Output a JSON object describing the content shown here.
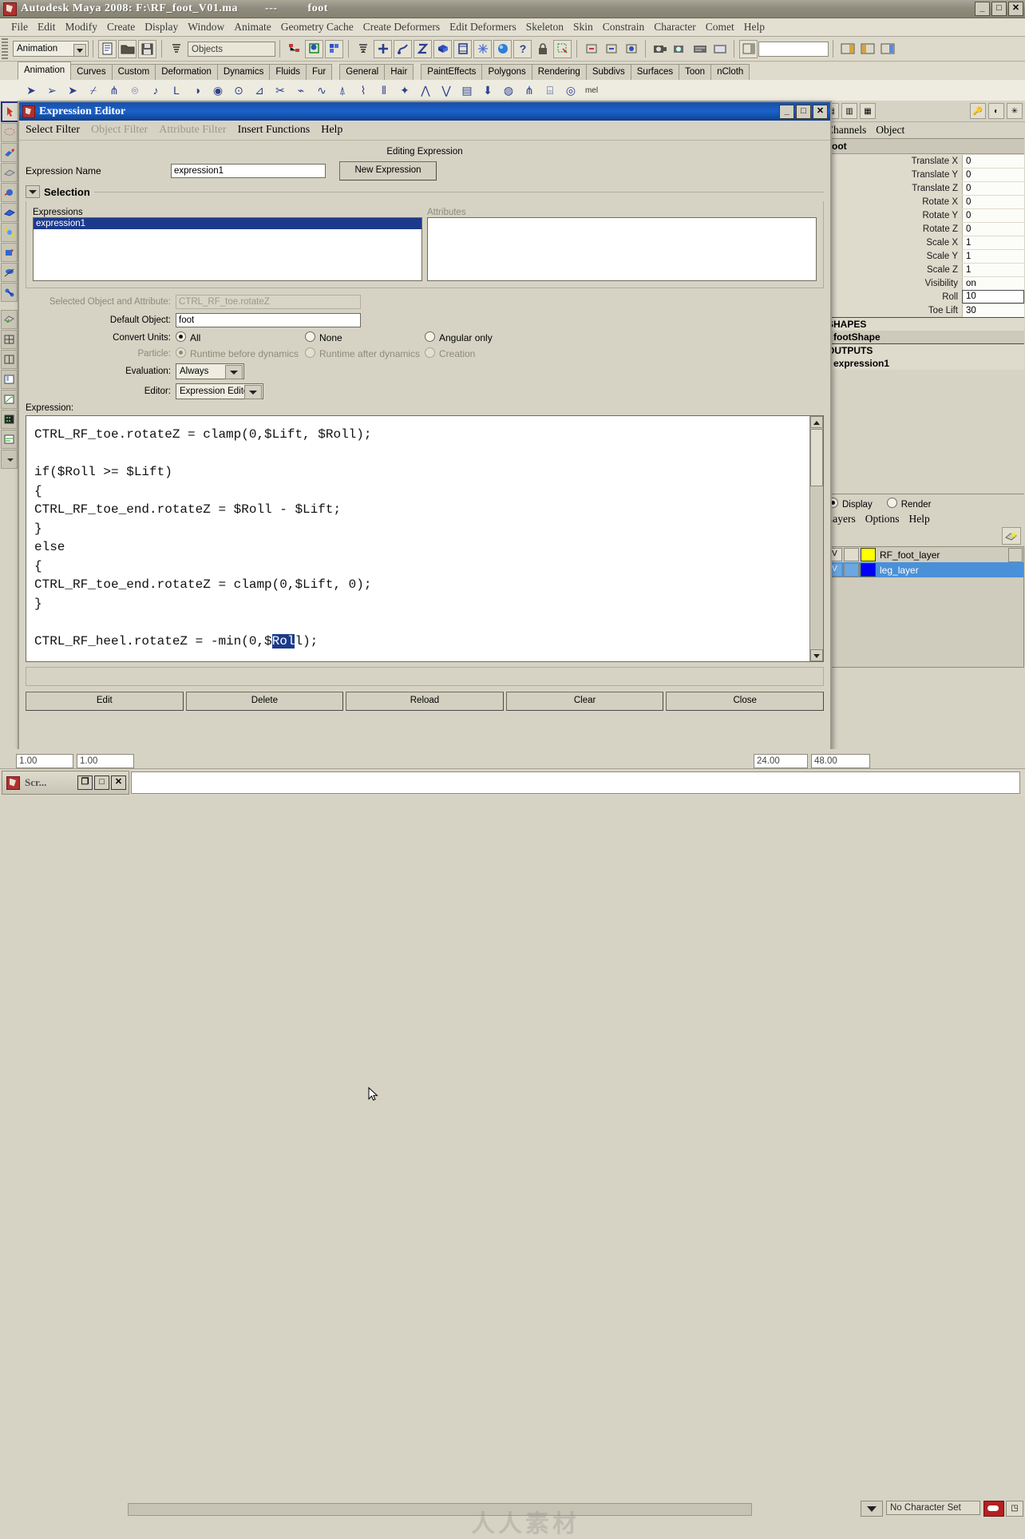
{
  "app": {
    "title": "Autodesk Maya 2008: F:\\RF_foot_V01.ma",
    "title_dash": "---",
    "title_object": "foot",
    "window_buttons": [
      "_",
      "□",
      "✕"
    ]
  },
  "menubar": {
    "items": [
      "File",
      "Edit",
      "Modify",
      "Create",
      "Display",
      "Window",
      "Animate",
      "Geometry Cache",
      "Create Deformers",
      "Edit Deformers",
      "Skeleton",
      "Skin",
      "Constrain",
      "Character",
      "Comet",
      "Help"
    ]
  },
  "toolbar": {
    "mode": "Animation",
    "selection_mask": "Objects",
    "numeric_input": "",
    "icons": [
      "new-scene-icon",
      "open-scene-icon",
      "save-scene-icon",
      "select-hierarchy-icon",
      "select-by-object-icon",
      "select-by-component-icon",
      "snap-grid-icon",
      "snap-curve-icon",
      "snap-point-icon",
      "snap-view-plane-icon",
      "snap-surface-icon",
      "construction-plane-icon",
      "make-live-icon",
      "history-icon",
      "render-icon",
      "help-icon",
      "lock-icon",
      "selection-set-icon"
    ]
  },
  "shelf": {
    "tabs": [
      "Animation",
      "Curves",
      "Custom",
      "Deformation",
      "Dynamics",
      "Fluids",
      "Fur",
      "General",
      "Hair",
      "PaintEffects",
      "Polygons",
      "Rendering",
      "Subdivs",
      "Surfaces",
      "Toon",
      "nCloth"
    ],
    "active_tab": "Animation",
    "last_icon_label": "mel"
  },
  "expression_editor": {
    "window_title": "Expression Editor",
    "window_buttons": [
      "_",
      "□",
      "✕"
    ],
    "menu": [
      {
        "label": "Select Filter",
        "enabled": true
      },
      {
        "label": "Object Filter",
        "enabled": false
      },
      {
        "label": "Attribute Filter",
        "enabled": false
      },
      {
        "label": "Insert Functions",
        "enabled": true
      },
      {
        "label": "Help",
        "enabled": true
      }
    ],
    "editing_label": "Editing Expression",
    "expression_name_label": "Expression Name",
    "expression_name_value": "expression1",
    "new_expression_button": "New Expression",
    "selection_group_label": "Selection",
    "expressions_list_label": "Expressions",
    "attributes_list_label": "Attributes",
    "expressions_items": [
      "expression1"
    ],
    "attributes_items": [],
    "selected_object_label": "Selected Object and Attribute:",
    "selected_object_value": "CTRL_RF_toe.rotateZ",
    "default_object_label": "Default Object:",
    "default_object_value": "foot",
    "convert_units_label": "Convert Units:",
    "convert_units_options": [
      "All",
      "None",
      "Angular only"
    ],
    "convert_units_selected": "All",
    "particle_label": "Particle:",
    "particle_options": [
      "Runtime before dynamics",
      "Runtime after dynamics",
      "Creation"
    ],
    "particle_selected": "Runtime before dynamics",
    "evaluation_label": "Evaluation:",
    "evaluation_value": "Always",
    "editor_label": "Editor:",
    "editor_value": "Expression Editor",
    "expression_label": "Expression:",
    "code_lines": [
      "CTRL_RF_toe.rotateZ = clamp(0,$Lift, $Roll);",
      "",
      "if($Roll >= $Lift)",
      "{",
      "CTRL_RF_toe_end.rotateZ = $Roll - $Lift;",
      "}",
      "else",
      "{",
      "CTRL_RF_toe_end.rotateZ = clamp(0,$Lift, 0);",
      "}",
      "",
      "CTRL_RF_heel.rotateZ = -min(0,$Roll);"
    ],
    "selected_text": "Rol",
    "last_line_prefix": "CTRL_RF_heel.rotateZ = -min(0,$",
    "last_line_suffix": "l);",
    "buttons": [
      "Edit",
      "Delete",
      "Reload",
      "Clear",
      "Close"
    ]
  },
  "right_panel": {
    "tabs_label": [
      "Channels",
      "Object"
    ],
    "object_name": "foot",
    "channels": [
      {
        "label": "Translate X",
        "value": "0"
      },
      {
        "label": "Translate Y",
        "value": "0"
      },
      {
        "label": "Translate Z",
        "value": "0"
      },
      {
        "label": "Rotate X",
        "value": "0"
      },
      {
        "label": "Rotate Y",
        "value": "0"
      },
      {
        "label": "Rotate Z",
        "value": "0"
      },
      {
        "label": "Scale X",
        "value": "1"
      },
      {
        "label": "Scale Y",
        "value": "1"
      },
      {
        "label": "Scale Z",
        "value": "1"
      },
      {
        "label": "Visibility",
        "value": "on"
      },
      {
        "label": "Roll",
        "value": "10",
        "active": true
      },
      {
        "label": "Toe Lift",
        "value": "30"
      }
    ],
    "shapes_header": "SHAPES",
    "shapes_items": [
      "footShape"
    ],
    "outputs_header": "OUTPUTS",
    "outputs_items": [
      "expression1"
    ],
    "display_render": [
      "Display",
      "Render"
    ],
    "display_render_selected": "Display",
    "layer_menu": [
      "Layers",
      "Options",
      "Help"
    ],
    "layers": [
      {
        "visible": "V",
        "color": "#ffff00",
        "name": "RF_foot_layer",
        "selected": false
      },
      {
        "visible": "V",
        "color": "#0000ff",
        "name": "leg_layer",
        "selected": true
      }
    ]
  },
  "timeline": {
    "start_field": "1.00",
    "range_start_field": "1.00",
    "range_end_field": "24.00",
    "end_field": "48.00",
    "character_set": "No Character Set",
    "page_prev": "<<",
    "page_next": ">>",
    "transport_icons": [
      "go-to-start-icon",
      "step-back-key-icon",
      "step-back-frame-icon",
      "play-backwards-icon",
      "play-forwards-icon",
      "step-forward-frame-icon",
      "step-forward-key-icon",
      "go-to-end-icon"
    ],
    "current_frame": ""
  },
  "script_window": {
    "title": "Scr...",
    "buttons": [
      "❐",
      "□",
      "✕"
    ]
  }
}
